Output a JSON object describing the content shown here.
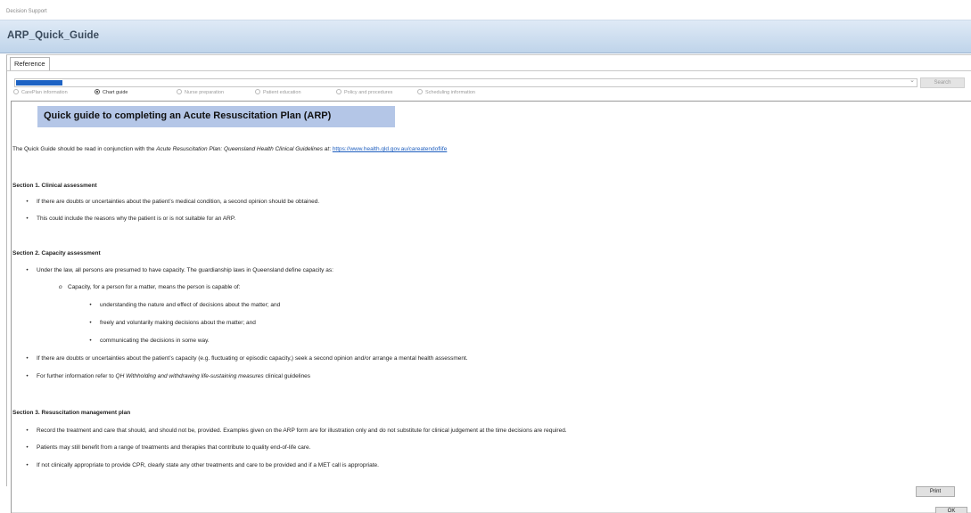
{
  "window": {
    "title": "Decision Support"
  },
  "header": {
    "title": "ARP_Quick_Guide"
  },
  "tabs": [
    {
      "label": "Reference"
    }
  ],
  "search": {
    "button_label": "Search"
  },
  "radios": [
    {
      "label": "CarePlan information",
      "selected": false
    },
    {
      "label": "Chart guide",
      "selected": true
    },
    {
      "label": "Nurse preparation",
      "selected": false
    },
    {
      "label": "Patient education",
      "selected": false
    },
    {
      "label": "Policy and procedures",
      "selected": false
    },
    {
      "label": "Scheduling information",
      "selected": false
    }
  ],
  "document": {
    "title": "Quick guide to completing an Acute Resuscitation Plan (ARP)",
    "intro_prefix": "The Quick Guide should be read in conjunction with the ",
    "intro_italic": "Acute Resuscitation Plan: Queensland Health Clinical Guidelines at",
    "intro_sep": ": ",
    "intro_link": "https://www.health.qld.gov.au/careatendoflife",
    "section1": {
      "heading": "Section 1. Clinical assessment",
      "b1": "If there are doubts or uncertainties about the patient’s medical condition, a second opinion should be obtained.",
      "b2": "This could include the reasons why the patient is or is not suitable for an ARP."
    },
    "section2": {
      "heading": "Section 2. Capacity assessment",
      "b1": "Under the law, all persons are presumed to have capacity. The guardianship laws in Queensland define capacity as:",
      "sub_marker": "o",
      "sub": "Capacity, for a person for a matter, means the person is capable of:",
      "s1": "understanding the nature and effect of decisions about the matter; and",
      "s2": "freely and voluntarily making decisions about the matter; and",
      "s3": "communicating the decisions in some way.",
      "b2": "If there are doubts or uncertainties about the patient’s capacity (e.g. fluctuating or episodic capacity,) seek a second opinion and/or arrange a mental health assessment.",
      "b3_prefix": "For further information refer to ",
      "b3_italic": "QH Withholding and withdrawing life-sustaining measures",
      "b3_suffix": " clinical guidelines"
    },
    "section3": {
      "heading": "Section 3. Resuscitation management plan",
      "b1": "Record the treatment and care that should, and should not be, provided.  Examples given on the ARP form are for illustration only and do not substitute for clinical judgement at the time decisions are required.",
      "b2": "Patients may still benefit from a range of treatments and therapies that contribute to quality end-of-life care.",
      "b3": "If not clinically appropriate to provide CPR, clearly state any other treatments and care to be provided and if a MET call is appropriate."
    }
  },
  "footer": {
    "print_label": "Print",
    "ok_label": "OK"
  }
}
